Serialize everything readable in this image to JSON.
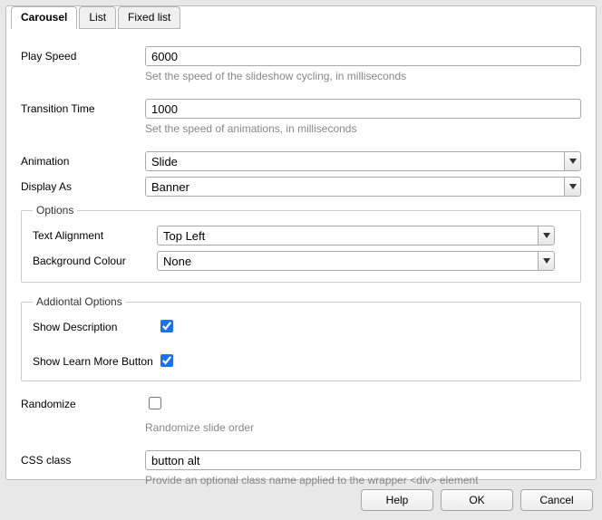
{
  "tabs": [
    {
      "label": "Carousel",
      "active": true
    },
    {
      "label": "List",
      "active": false
    },
    {
      "label": "Fixed list",
      "active": false
    }
  ],
  "fields": {
    "play_speed": {
      "label": "Play Speed",
      "value": "6000",
      "hint": "Set the speed of the slideshow cycling, in milliseconds"
    },
    "transition_time": {
      "label": "Transition Time",
      "value": "1000",
      "hint": "Set the speed of animations, in milliseconds"
    },
    "animation": {
      "label": "Animation",
      "value": "Slide"
    },
    "display_as": {
      "label": "Display As",
      "value": "Banner"
    },
    "randomize": {
      "label": "Randomize",
      "checked": false,
      "hint": "Randomize slide order"
    },
    "css_class": {
      "label": "CSS class",
      "value": "button alt",
      "hint": "Provide an optional class name applied to the wrapper <div> element"
    }
  },
  "options_group": {
    "legend": "Options",
    "text_alignment": {
      "label": "Text Alignment",
      "value": "Top Left"
    },
    "background_colour": {
      "label": "Background Colour",
      "value": "None"
    }
  },
  "additional_group": {
    "legend": "Addiontal Options",
    "show_description": {
      "label": "Show Description",
      "checked": true
    },
    "show_learn_more": {
      "label": "Show Learn More Button",
      "checked": true
    }
  },
  "buttons": {
    "help": "Help",
    "ok": "OK",
    "cancel": "Cancel"
  }
}
